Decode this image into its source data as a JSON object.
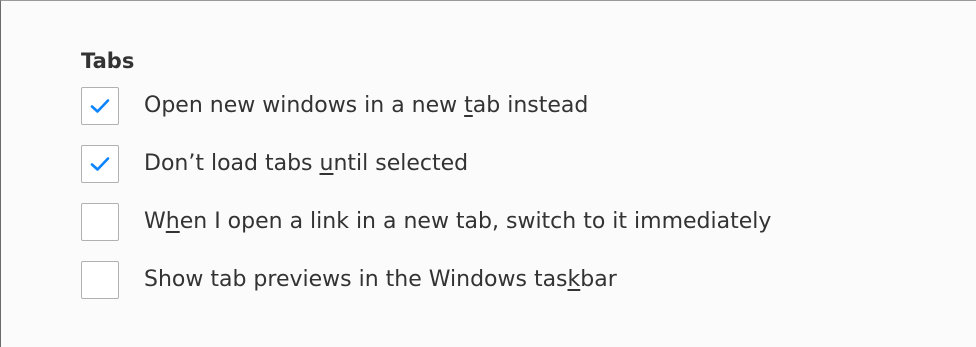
{
  "section": {
    "title": "Tabs"
  },
  "options": [
    {
      "pre": "Open new windows in a new ",
      "key": "t",
      "post": "ab instead",
      "checked": true
    },
    {
      "pre": "Don’t load tabs ",
      "key": "u",
      "post": "ntil selected",
      "checked": true
    },
    {
      "pre": "W",
      "key": "h",
      "post": "en I open a link in a new tab, switch to it immediately",
      "checked": false
    },
    {
      "pre": "Show tab previews in the Windows tas",
      "key": "k",
      "post": "bar",
      "checked": false
    }
  ],
  "colors": {
    "check_mark": "#0a84ff",
    "text": "#333333",
    "checkbox_border": "#b1b1b3"
  },
  "icons": {
    "check": "checkmark-icon"
  }
}
